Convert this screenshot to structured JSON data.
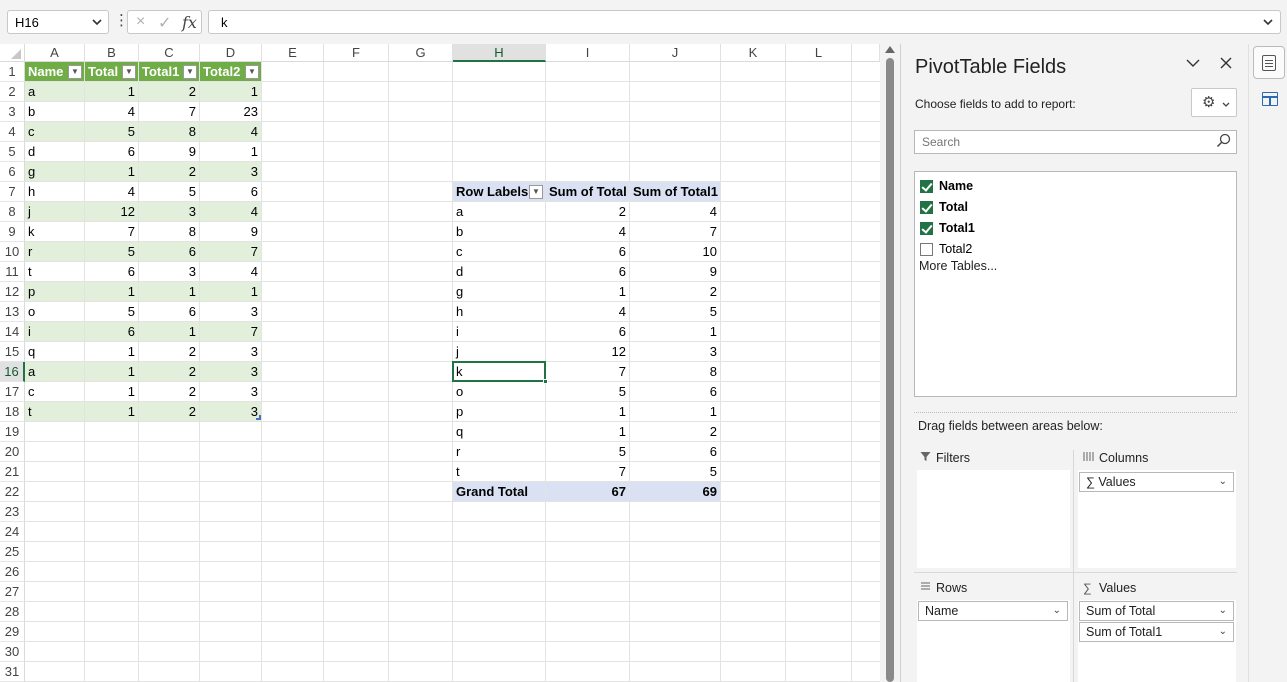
{
  "formula_bar": {
    "name_box": "H16",
    "formula": "k",
    "more_icon": "vertical-dots",
    "cancel_icon": "×",
    "enter_icon": "✓",
    "fx_label": "fx"
  },
  "grid": {
    "columns": [
      "A",
      "B",
      "C",
      "D",
      "E",
      "F",
      "G",
      "H",
      "I",
      "J",
      "K",
      "L"
    ],
    "extra_column": "",
    "selected_column": "H",
    "selected_row": 16,
    "rows": [
      1,
      2,
      3,
      4,
      5,
      6,
      7,
      8,
      9,
      10,
      11,
      12,
      13,
      14,
      15,
      16,
      17,
      18,
      19,
      20,
      21,
      22,
      23,
      24,
      25,
      26,
      27,
      28,
      29,
      30,
      31
    ]
  },
  "table": {
    "headers": [
      "Name",
      "Total",
      "Total1",
      "Total2"
    ],
    "rows": [
      [
        "a",
        1,
        2,
        1
      ],
      [
        "b",
        4,
        7,
        23
      ],
      [
        "c",
        5,
        8,
        4
      ],
      [
        "d",
        6,
        9,
        1
      ],
      [
        "g",
        1,
        2,
        3
      ],
      [
        "h",
        4,
        5,
        6
      ],
      [
        "j",
        12,
        3,
        4
      ],
      [
        "k",
        7,
        8,
        9
      ],
      [
        "r",
        5,
        6,
        7
      ],
      [
        "t",
        6,
        3,
        4
      ],
      [
        "p",
        1,
        1,
        1
      ],
      [
        "o",
        5,
        6,
        3
      ],
      [
        "i",
        6,
        1,
        7
      ],
      [
        "q",
        1,
        2,
        3
      ],
      [
        "a",
        1,
        2,
        3
      ],
      [
        "c",
        1,
        2,
        3
      ],
      [
        "t",
        1,
        2,
        3
      ]
    ],
    "header_color": "#70ad47",
    "band_color": "#e2efda"
  },
  "pivot": {
    "headers": [
      "Row Labels",
      "Sum of Total",
      "Sum of Total1"
    ],
    "rows": [
      [
        "a",
        2,
        4
      ],
      [
        "b",
        4,
        7
      ],
      [
        "c",
        6,
        10
      ],
      [
        "d",
        6,
        9
      ],
      [
        "g",
        1,
        2
      ],
      [
        "h",
        4,
        5
      ],
      [
        "i",
        6,
        1
      ],
      [
        "j",
        12,
        3
      ],
      [
        "k",
        7,
        8
      ],
      [
        "o",
        5,
        6
      ],
      [
        "p",
        1,
        1
      ],
      [
        "q",
        1,
        2
      ],
      [
        "r",
        5,
        6
      ],
      [
        "t",
        7,
        5
      ]
    ],
    "grand_total": [
      "Grand Total",
      67,
      69
    ],
    "header_color": "#d9e1f2"
  },
  "pane": {
    "title": "PivotTable Fields",
    "subtitle": "Choose fields to add to report:",
    "search_placeholder": "Search",
    "fields": [
      {
        "label": "Name",
        "checked": true
      },
      {
        "label": "Total",
        "checked": true
      },
      {
        "label": "Total1",
        "checked": true
      },
      {
        "label": "Total2",
        "checked": false
      }
    ],
    "more_tables": "More Tables...",
    "drag_label": "Drag fields between areas below:",
    "areas": {
      "filters": {
        "label": "Filters",
        "items": []
      },
      "columns": {
        "label": "Columns",
        "items": [
          "∑ Values"
        ]
      },
      "rows": {
        "label": "Rows",
        "items": [
          "Name"
        ]
      },
      "values": {
        "label": "Values",
        "items": [
          "Sum of Total",
          "Sum of Total1"
        ]
      }
    },
    "accent": "#217346"
  }
}
